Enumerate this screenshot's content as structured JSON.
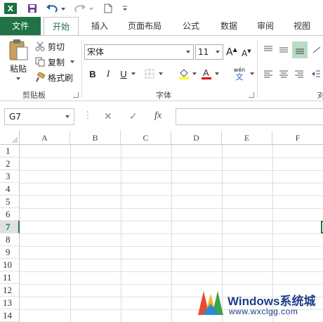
{
  "quick_access": {
    "app_icon": "excel-logo",
    "app_letter": "X",
    "save_icon": "save-icon",
    "undo_icon": "undo-icon",
    "redo_icon": "redo-icon",
    "new_icon": "new-document-icon",
    "customize_icon": "customize-dropdown-icon"
  },
  "tabs": {
    "file": "文件",
    "home": "开始",
    "insert": "插入",
    "page_layout": "页面布局",
    "formulas": "公式",
    "data": "数据",
    "review": "审阅",
    "view": "视图"
  },
  "clipboard": {
    "paste": "粘贴",
    "cut": "剪切",
    "copy": "复制",
    "format_painter": "格式刷",
    "group_label": "剪贴板"
  },
  "font": {
    "font_name": "宋体",
    "font_size": "11",
    "bold": "B",
    "italic": "I",
    "underline": "U",
    "wen": "wén",
    "wen_char": "文",
    "group_label": "字体",
    "fill_color": "#ffff00",
    "font_color": "#e00000"
  },
  "alignment": {
    "group_label_partial": "对"
  },
  "formula_bar": {
    "name_box": "G7",
    "fx": "fx",
    "cancel": "✕",
    "enter": "✓",
    "formula_value": ""
  },
  "grid": {
    "columns": [
      "A",
      "B",
      "C",
      "D",
      "E",
      "F"
    ],
    "rows": [
      "1",
      "2",
      "3",
      "4",
      "5",
      "6",
      "7",
      "8",
      "9",
      "10",
      "11",
      "12",
      "13",
      "14"
    ],
    "selected_row": "7"
  },
  "watermark": {
    "title": "Windows系统城",
    "url": "www.wxclgg.com"
  },
  "colors": {
    "excel_green": "#217346",
    "watermark_blue": "#1e3d8a"
  }
}
